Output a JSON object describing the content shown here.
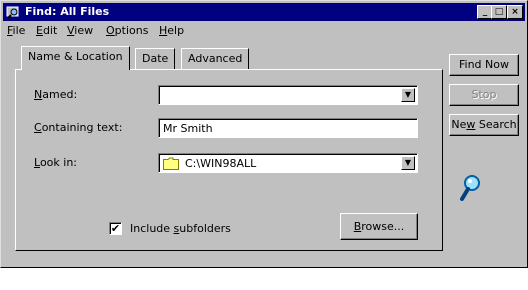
{
  "window": {
    "title": "Find: All Files"
  },
  "title_buttons": [
    "minimize",
    "maximize",
    "close"
  ],
  "menubar": [
    {
      "label": "File",
      "mnemonic": "F",
      "rest": "ile"
    },
    {
      "label": "Edit",
      "mnemonic": "E",
      "rest": "dit"
    },
    {
      "label": "View",
      "mnemonic": "V",
      "rest": "iew"
    },
    {
      "label": "Options",
      "mnemonic": "O",
      "rest": "ptions"
    },
    {
      "label": "Help",
      "mnemonic": "H",
      "rest": "elp"
    }
  ],
  "tabs": [
    {
      "label": "Name & Location",
      "active": true
    },
    {
      "label": "Date",
      "active": false
    },
    {
      "label": "Advanced",
      "active": false
    }
  ],
  "form": {
    "named": {
      "mnemonic": "N",
      "rest": "amed:",
      "value": ""
    },
    "containing": {
      "mnemonic": "C",
      "rest": "ontaining text:",
      "value": "Mr Smith"
    },
    "lookin": {
      "mnemonic": "L",
      "rest": "ook in:",
      "value": "C:\\WIN98ALL",
      "icon": "folder-icon"
    },
    "subfolders": {
      "pre": "Include ",
      "mnemonic": "s",
      "rest": "ubfolders",
      "checked": true,
      "check_mark": "✔"
    },
    "browse": {
      "mnemonic": "B",
      "rest": "rowse..."
    }
  },
  "actions": {
    "find_now": "Find Now",
    "stop": "Stop",
    "new_search": {
      "pre": "Ne",
      "mnemonic": "w",
      "rest": " Search"
    }
  },
  "icons": {
    "search": "magnifier-icon"
  },
  "colors": {
    "titlebar": "#000080",
    "face": "#c0c0c0",
    "folder": "#ffff80"
  }
}
